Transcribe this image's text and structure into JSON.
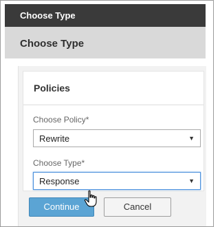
{
  "window": {
    "title": "Choose Type"
  },
  "header": {
    "title": "Choose Type"
  },
  "card": {
    "title": "Policies"
  },
  "form": {
    "policy_label": "Choose Policy*",
    "policy_value": "Rewrite",
    "type_label": "Choose Type*",
    "type_value": "Response",
    "dropdown_arrow": "▼"
  },
  "actions": {
    "continue_label": "Continue",
    "cancel_label": "Cancel"
  },
  "colors": {
    "title_bar": "#3a3a3a",
    "primary_button": "#5ba4d4",
    "focus_border": "#4a8fdc"
  },
  "icons": {
    "cursor": "hand-pointer-icon"
  }
}
